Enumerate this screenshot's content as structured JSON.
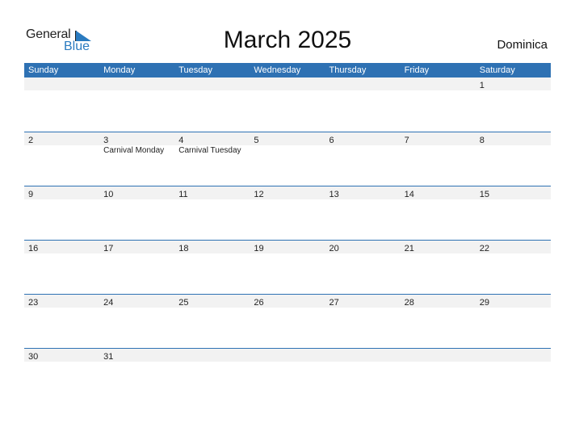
{
  "logo": {
    "word1": "General",
    "word2": "Blue"
  },
  "title": "March 2025",
  "country": "Dominica",
  "colors": {
    "accent": "#2e71b3",
    "strip": "#f2f2f2"
  },
  "weekdays": [
    "Sunday",
    "Monday",
    "Tuesday",
    "Wednesday",
    "Thursday",
    "Friday",
    "Saturday"
  ],
  "weeks": [
    [
      {
        "d": ""
      },
      {
        "d": ""
      },
      {
        "d": ""
      },
      {
        "d": ""
      },
      {
        "d": ""
      },
      {
        "d": ""
      },
      {
        "d": "1"
      }
    ],
    [
      {
        "d": "2"
      },
      {
        "d": "3",
        "h": "Carnival Monday"
      },
      {
        "d": "4",
        "h": "Carnival Tuesday"
      },
      {
        "d": "5"
      },
      {
        "d": "6"
      },
      {
        "d": "7"
      },
      {
        "d": "8"
      }
    ],
    [
      {
        "d": "9"
      },
      {
        "d": "10"
      },
      {
        "d": "11"
      },
      {
        "d": "12"
      },
      {
        "d": "13"
      },
      {
        "d": "14"
      },
      {
        "d": "15"
      }
    ],
    [
      {
        "d": "16"
      },
      {
        "d": "17"
      },
      {
        "d": "18"
      },
      {
        "d": "19"
      },
      {
        "d": "20"
      },
      {
        "d": "21"
      },
      {
        "d": "22"
      }
    ],
    [
      {
        "d": "23"
      },
      {
        "d": "24"
      },
      {
        "d": "25"
      },
      {
        "d": "26"
      },
      {
        "d": "27"
      },
      {
        "d": "28"
      },
      {
        "d": "29"
      }
    ],
    [
      {
        "d": "30"
      },
      {
        "d": "31"
      },
      {
        "d": ""
      },
      {
        "d": ""
      },
      {
        "d": ""
      },
      {
        "d": ""
      },
      {
        "d": ""
      }
    ]
  ]
}
